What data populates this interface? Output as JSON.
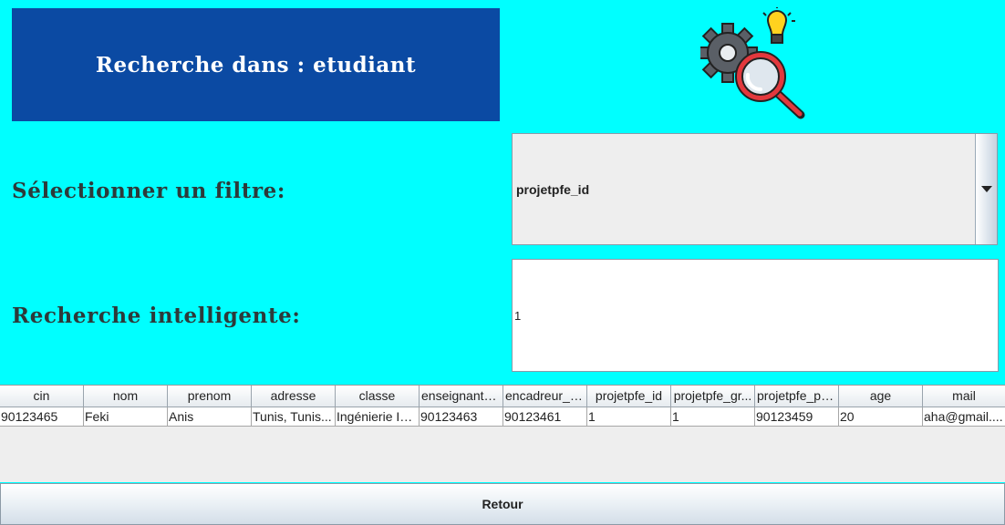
{
  "header": {
    "title": "Recherche dans : etudiant",
    "logo_icon": "gears-search-lightbulb-icon"
  },
  "filter": {
    "label": "Sélectionner un filtre:",
    "selected": "projetpfe_id",
    "arrow_icon": "chevron-down-icon"
  },
  "search": {
    "label": "Recherche intelligente:",
    "value": "1"
  },
  "table": {
    "columns": [
      "cin",
      "nom",
      "prenom",
      "adresse",
      "classe",
      "enseignant_...",
      "encadreur_d...",
      "projetpfe_id",
      "projetpfe_gr...",
      "projetpfe_pe...",
      "age",
      "mail"
    ],
    "rows": [
      [
        "90123465",
        "Feki",
        "Anis",
        "Tunis, Tunis...",
        "Ingénierie Inf...",
        "90123463",
        "90123461",
        "1",
        "1",
        "90123459",
        "20",
        "aha@gmail...."
      ]
    ]
  },
  "footer": {
    "back_label": "Retour"
  },
  "colors": {
    "background": "#00ffff",
    "banner": "#0b4aa3",
    "label_text": "#2d3a3a"
  }
}
